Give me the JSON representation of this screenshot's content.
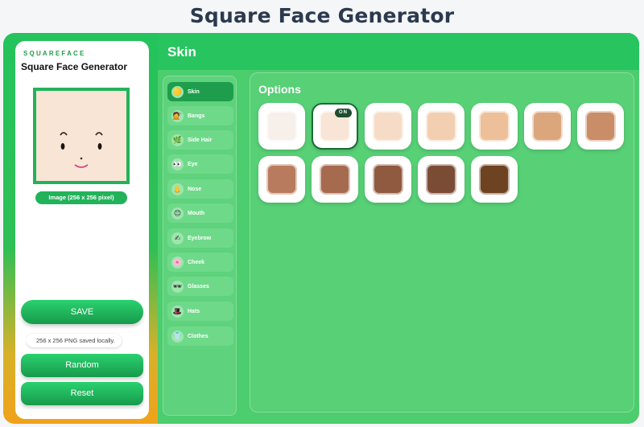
{
  "page": {
    "title": "Square Face Generator"
  },
  "left_panel": {
    "brand": "SQUAREFACE",
    "title": "Square Face Generator",
    "image_caption": "Image (256 x 256 pixel)",
    "save_label": "SAVE",
    "toast_text": "256 x 256 PNG saved locally.",
    "random_label": "Random",
    "reset_label": "Reset"
  },
  "section": {
    "title": "Skin"
  },
  "nav": {
    "items": [
      {
        "label": "Skin",
        "icon": "🟡"
      },
      {
        "label": "Bangs",
        "icon": "💇"
      },
      {
        "label": "Side Hair",
        "icon": "🌿"
      },
      {
        "label": "Eye",
        "icon": "👀"
      },
      {
        "label": "Nose",
        "icon": "👃"
      },
      {
        "label": "Mouth",
        "icon": "😊"
      },
      {
        "label": "Eyebrow",
        "icon": "✍"
      },
      {
        "label": "Cheek",
        "icon": "🌸"
      },
      {
        "label": "Glasses",
        "icon": "🕶"
      },
      {
        "label": "Hats",
        "icon": "🎩"
      },
      {
        "label": "Clothes",
        "icon": "👕"
      }
    ],
    "active": "Skin"
  },
  "options": {
    "title": "Options",
    "selected_badge": "ON",
    "selected_index": 1,
    "swatch_colors": [
      "#f7efea",
      "#f8e5d6",
      "#f6dcc6",
      "#f2cfb1",
      "#eec09a",
      "#dca67d",
      "#c98d68",
      "#b97b5d",
      "#a66a4f",
      "#8f5a40",
      "#7a4c36",
      "#6e4322"
    ]
  }
}
